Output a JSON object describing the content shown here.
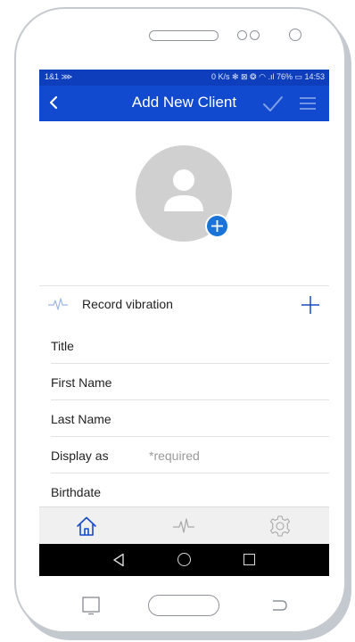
{
  "status_bar": {
    "carrier": "1&1 ⋙",
    "indicators": "0 K/s ✻ ⊠ ❂ ◠ .ıl 76% ▭ 14:53"
  },
  "header": {
    "title": "Add New Client"
  },
  "record": {
    "label": "Record vibration"
  },
  "fields": [
    {
      "label": "Title",
      "hint": ""
    },
    {
      "label": "First Name",
      "hint": ""
    },
    {
      "label": "Last Name",
      "hint": ""
    },
    {
      "label": "Display as",
      "hint": "*required"
    },
    {
      "label": "Birthdate",
      "hint": ""
    }
  ],
  "tabs": [
    {
      "icon": "home-icon",
      "active": true
    },
    {
      "icon": "pulse-icon",
      "active": false
    },
    {
      "icon": "gear-icon",
      "active": false
    }
  ],
  "colors": {
    "appbar": "#1149cf",
    "statusbar": "#0f3ebd",
    "accent": "#1a73d8",
    "avatar_bg": "#cfd0cf"
  }
}
